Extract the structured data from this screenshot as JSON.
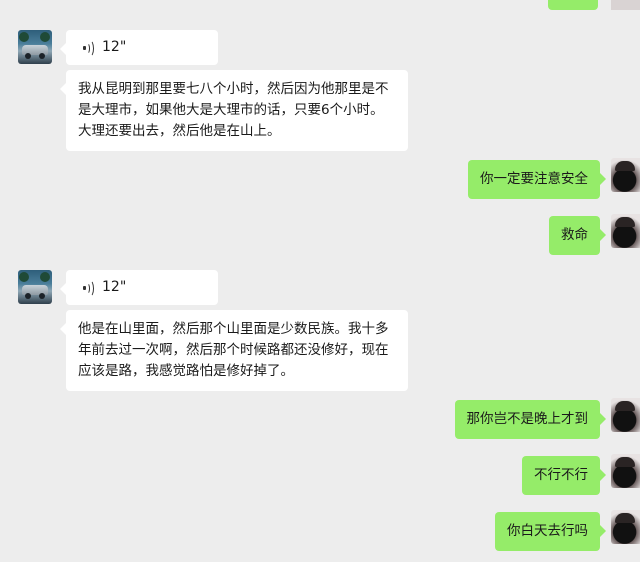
{
  "messages": [
    {
      "side": "left",
      "type": "voice",
      "duration": "12\""
    },
    {
      "side": "left",
      "type": "text",
      "text": "我从昆明到那里要七八个小时，然后因为他那里是不是大理市，如果他大是大理市的话，只要6个小时。大理还要出去，然后他是在山上。"
    },
    {
      "side": "right",
      "type": "text",
      "text": "你一定要注意安全"
    },
    {
      "side": "right",
      "type": "text",
      "text": "救命"
    },
    {
      "side": "left",
      "type": "voice",
      "duration": "12\""
    },
    {
      "side": "left",
      "type": "text",
      "text": "他是在山里面，然后那个山里面是少数民族。我十多年前去过一次啊，然后那个时候路都还没修好，现在应该是路，我感觉路怕是修好掉了。"
    },
    {
      "side": "right",
      "type": "text",
      "text": "那你岂不是晚上才到"
    },
    {
      "side": "right",
      "type": "text",
      "text": "不行不行"
    },
    {
      "side": "right",
      "type": "text",
      "text": "你白天去行吗"
    }
  ],
  "icons": {
    "voice": "voice-wave-icon",
    "left_avatar": "car-avatar",
    "right_avatar": "person-avatar"
  },
  "colors": {
    "background": "#ededed",
    "left_bubble": "#ffffff",
    "right_bubble": "#95ec69"
  }
}
